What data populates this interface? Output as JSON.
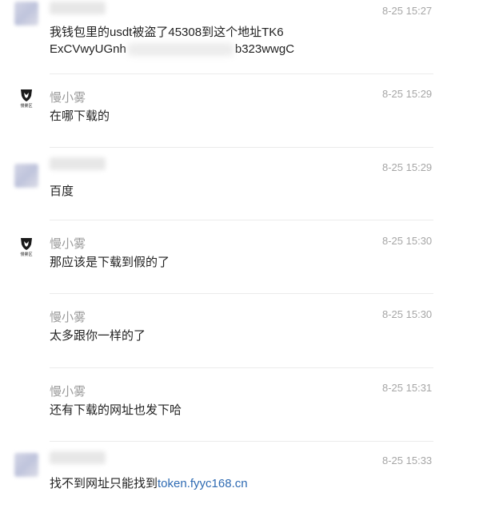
{
  "messages": [
    {
      "sender": "",
      "time": "8-25 15:27",
      "line1": "我钱包里的usdt被盗了45308到这个地址TK6",
      "line2_start": "ExCVwyUGnh",
      "line2_end": "b323wwgC"
    },
    {
      "sender": "慢小雾",
      "time": "8-25 15:29",
      "text": "在哪下载的",
      "logo_caption": "慢雾区"
    },
    {
      "sender": "",
      "time": "8-25 15:29",
      "text": "百度"
    },
    {
      "sender": "慢小雾",
      "time": "8-25 15:30",
      "text": "那应该是下载到假的了",
      "logo_caption": "慢雾区"
    },
    {
      "sender": "慢小雾",
      "time": "8-25 15:30",
      "text": "太多跟你一样的了"
    },
    {
      "sender": "慢小雾",
      "time": "8-25 15:31",
      "text": "还有下载的网址也发下哈"
    },
    {
      "sender": "",
      "time": "8-25 15:33",
      "text_prefix": "找不到网址只能找到",
      "link_text": "token.fyyc168.cn"
    }
  ],
  "colors": {
    "text": "#222222",
    "meta": "#a6a6a6",
    "link": "#2f6bb3",
    "divider": "#ebebeb"
  }
}
